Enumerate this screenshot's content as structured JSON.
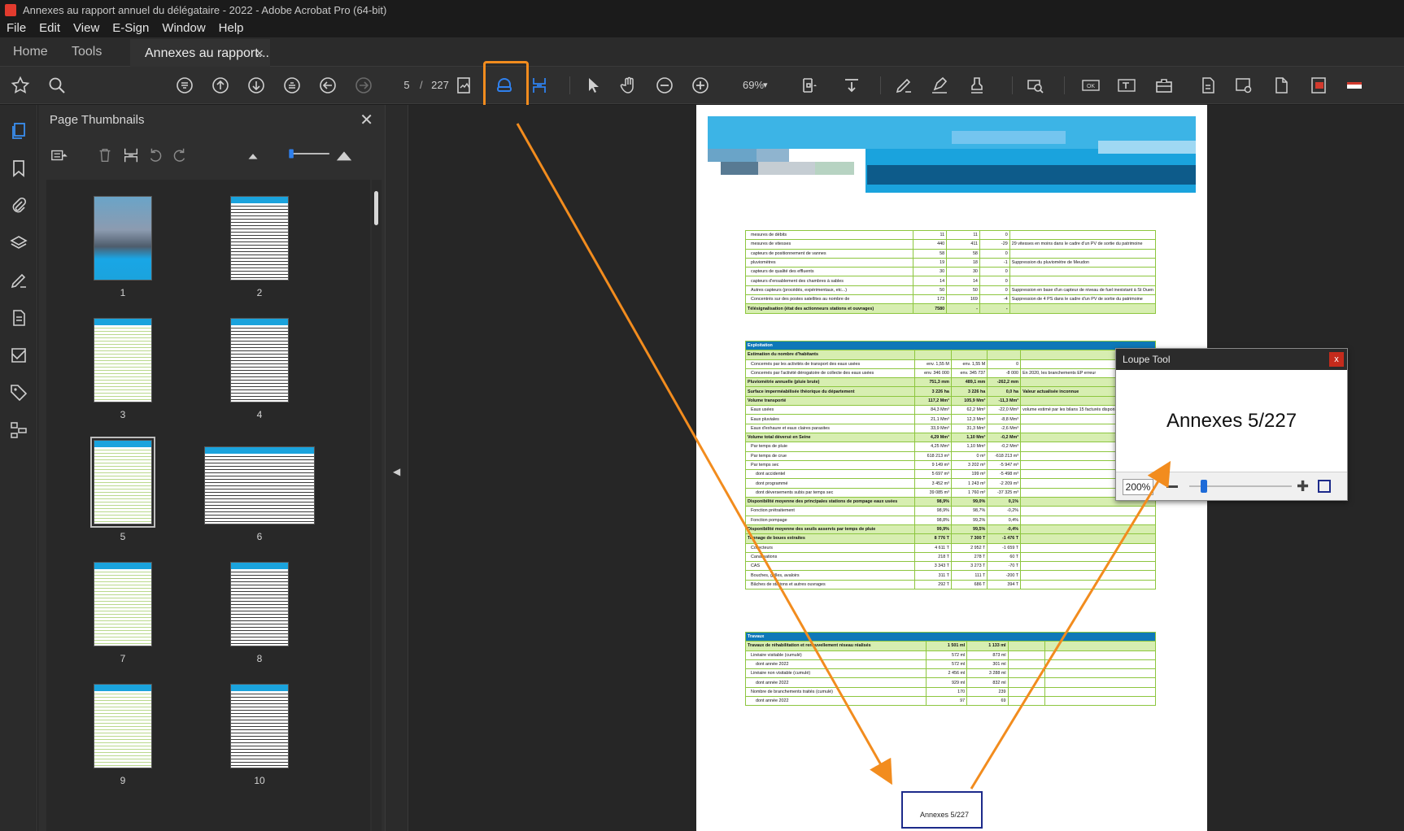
{
  "window": {
    "title": "Annexes au rapport annuel du délégataire - 2022 - Adobe Acrobat Pro (64-bit)"
  },
  "menu": [
    "File",
    "Edit",
    "View",
    "E-Sign",
    "Window",
    "Help"
  ],
  "tabs": {
    "home": "Home",
    "tools": "Tools",
    "doc": "Annexes au rapport...",
    "close": "×"
  },
  "toolbar": {
    "page_current": "5",
    "page_sep": "/",
    "page_total": "227",
    "zoom": "69%",
    "icons": [
      "bookmark-star-icon",
      "search-icon",
      "first-page-icon",
      "prev-page-icon",
      "next-page-icon",
      "last-page-icon",
      "back-icon",
      "forward-icon",
      "page-view-icon",
      "loupe-tool-icon",
      "pan-zoom-icon",
      "select-icon",
      "hand-icon",
      "zoom-out-icon",
      "zoom-in-icon",
      "fit-page-icon",
      "scroll-icon",
      "sign-icon",
      "highlight-icon",
      "stamp-icon",
      "find-icon",
      "ok-icon",
      "text-field-icon",
      "toolbox-icon",
      "export-icon",
      "settings-icon",
      "page-icon",
      "pdf-icon",
      "flag-icon"
    ]
  },
  "left_rail": [
    "pages-icon",
    "bookmarks-icon",
    "attachments-icon",
    "layers-icon",
    "signatures-icon",
    "content-icon",
    "compare-icon",
    "tags-icon",
    "order-icon"
  ],
  "thumbnails_panel": {
    "title": "Page Thumbnails",
    "close": "✕",
    "labels": [
      "1",
      "2",
      "3",
      "4",
      "5",
      "6",
      "7",
      "8",
      "9",
      "10"
    ]
  },
  "document": {
    "rows_a": [
      [
        "mesures de débits",
        "11",
        "11",
        "0",
        ""
      ],
      [
        "mesures de vitesses",
        "440",
        "411",
        "-29",
        "29 vitesses en moins dans le cadre d'un PV de sortie du patrimoine"
      ],
      [
        "capteurs de positionnement de vannes",
        "58",
        "58",
        "0",
        ""
      ],
      [
        "pluviomètres",
        "19",
        "18",
        "-1",
        "Suppression du pluviomètre de Meudon"
      ],
      [
        "capteurs de qualité des effluents",
        "30",
        "30",
        "0",
        ""
      ],
      [
        "capteurs d'ensablement des chambres à sables",
        "14",
        "14",
        "0",
        ""
      ],
      [
        "Autres capteurs (procédés, expérimentaux, etc...)",
        "50",
        "50",
        "0",
        "Suppression en base d'un capteur de niveau de fuel inexistant à St Ouen"
      ],
      [
        "Concentrés sur des postes satellites au nombre de",
        "173",
        "169",
        "-4",
        "Suppression de 4 PS dans le cadre d'un PV de sortie du patrimoine"
      ],
      [
        "Télésignalisation (état des actionneurs stations et ouvrages)",
        "7580",
        "-",
        "-",
        ""
      ]
    ],
    "rows_b_head": "Exploitation",
    "rows_b": [
      [
        "Estimation du nombre d'habitants",
        "",
        "",
        "",
        ""
      ],
      [
        "Concernés par les activités de transport des eaux usées",
        "env. 1,55 M",
        "env. 1,55 M",
        "0",
        ""
      ],
      [
        "Concernés par l'activité dérogatoire de collecte des eaux usées",
        "env. 346 000",
        "env. 345 737",
        "-8 000",
        "En 2020, les branchements EP erreur"
      ],
      [
        "Pluviométrie annuelle (pluie brute)",
        "751,3 mm",
        "489,1 mm",
        "-262,2 mm",
        ""
      ],
      [
        "Surface imperméabilisée théorique du département",
        "3 226 ha",
        "3 226 ha",
        "0,0 ha",
        "Valeur actualisée inconnue"
      ],
      [
        "Volume transporté",
        "117,2 Mm³",
        "105,9 Mm³",
        "-11,3 Mm³",
        ""
      ],
      [
        "Eaux usées",
        "84,3 Mm³",
        "62,2 Mm³",
        "-22,0 Mm³",
        "volume estimé par les bilans 15 facturés disponibles après le valida"
      ],
      [
        "Eaux pluviales",
        "21,1 Mm³",
        "12,3 Mm³",
        "-8,8 Mm³",
        ""
      ],
      [
        "Eaux d'exhaure et eaux claires parasites",
        "33,9 Mm³",
        "31,3 Mm³",
        "-2,6 Mm³",
        ""
      ],
      [
        "Volume total déversé en Seine",
        "4,29 Mm³",
        "1,10 Mm³",
        "-0,2 Mm³",
        ""
      ],
      [
        "Par temps de pluie",
        "4,25 Mm³",
        "1,10 Mm³",
        "-0,2 Mm³",
        ""
      ],
      [
        "Par temps de crue",
        "618 213 m³",
        "0 m³",
        "-618 213 m³",
        ""
      ],
      [
        "Par temps sec",
        "9 149 m³",
        "3 202 m³",
        "-5 947 m³",
        ""
      ],
      [
        "dont accidentel",
        "5 697 m³",
        "199 m³",
        "-5 498 m³",
        ""
      ],
      [
        "dont programmé",
        "3 452 m³",
        "1 243 m³",
        "-2 209 m³",
        ""
      ],
      [
        "dont déversements subis par temps sec",
        "39 085 m³",
        "1 760 m³",
        "-37 325 m³",
        ""
      ],
      [
        "Disponibilité moyenne des principales stations de pompage eaux usées",
        "98,9%",
        "99,0%",
        "0,1%",
        ""
      ],
      [
        "Fonction prétraitement",
        "98,9%",
        "98,7%",
        "-0,2%",
        ""
      ],
      [
        "Fonction pompage",
        "98,8%",
        "99,2%",
        "0,4%",
        ""
      ],
      [
        "Disponibilité moyenne des seuils asservis par temps de pluie",
        "99,9%",
        "99,5%",
        "-0,4%",
        ""
      ],
      [
        "Tonnage de boues extraites",
        "8 776 T",
        "7 300 T",
        "-1 476 T",
        ""
      ],
      [
        "Collecteurs",
        "4 611 T",
        "2 952 T",
        "-1 659 T",
        ""
      ],
      [
        "Canalisations",
        "218 T",
        "278 T",
        "60 T",
        ""
      ],
      [
        "CAS",
        "3 343 T",
        "3 273 T",
        "-70 T",
        ""
      ],
      [
        "Bouches, grilles, avaloirs",
        "311 T",
        "111 T",
        "-200 T",
        ""
      ],
      [
        "Bâches de stations et autres ouvrages",
        "292 T",
        "686 T",
        "394 T",
        ""
      ]
    ],
    "rows_c_head": "Travaux",
    "rows_c": [
      [
        "Travaux de réhabilitation et renouvellement réseau réalisés",
        "1 501 ml",
        "1 133 ml",
        "",
        ""
      ],
      [
        "Linéaire visitable (cumulé)",
        "572 ml",
        "873 ml",
        "",
        ""
      ],
      [
        "dont année 2022",
        "572 ml",
        "301 ml",
        "",
        ""
      ],
      [
        "Linéaire non visitable (cumulé)",
        "2 456 ml",
        "3 288 ml",
        "",
        ""
      ],
      [
        "dont année 2022",
        "929 ml",
        "832 ml",
        "",
        ""
      ],
      [
        "Nombre de branchements traités (cumulé)",
        "170",
        "239",
        "",
        ""
      ],
      [
        "dont année 2022",
        "97",
        "69",
        "",
        ""
      ]
    ],
    "footer": "Annexes 5/227"
  },
  "loupe": {
    "title": "Loupe Tool",
    "close": "x",
    "text": "Annexes 5/227",
    "zoom": "200%"
  },
  "colors": {
    "accent": "#f28c1e",
    "active_tool": "#2f80ed",
    "green_table": "#8dc63f",
    "blue_header": "#0e78b8"
  }
}
